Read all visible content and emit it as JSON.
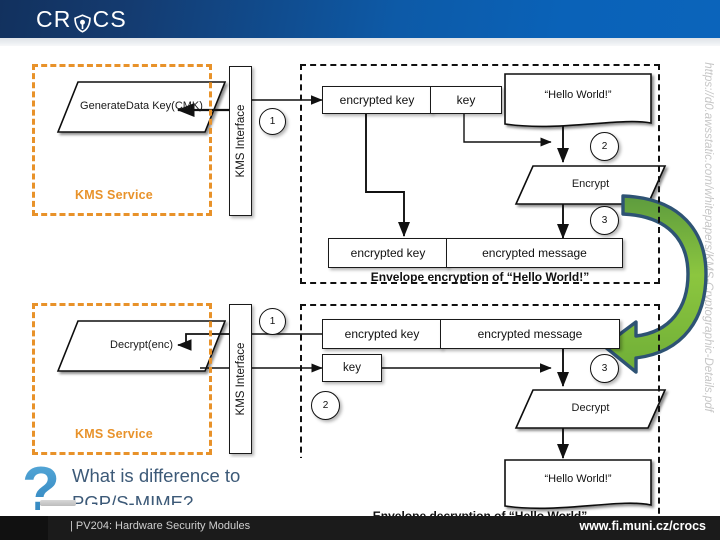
{
  "header": {
    "logo_text_left": "CR",
    "logo_mark": "crocs-shield-icon",
    "logo_text_right": "CS"
  },
  "source_url": "https://d0.awsstatic.com/whitepapers/KMS-Cryptographic-Details.pdf",
  "top_diagram": {
    "kms_service_label": "KMS Service",
    "operation_shape": "GenerateData Key(CMK)",
    "interface_label": "KMS Interface",
    "steps": [
      "1",
      "2",
      "3"
    ],
    "encrypted_key_label": "encrypted key",
    "key_label": "key",
    "plaintext_note": "“Hello World!”",
    "crypto_op": "Encrypt",
    "out_encrypted_key": "encrypted key",
    "out_encrypted_message": "encrypted message",
    "caption": "Envelope encryption of “Hello World!”"
  },
  "bottom_diagram": {
    "kms_service_label": "KMS Service",
    "operation_shape": "Decrypt(enc)",
    "interface_label": "KMS Interface",
    "steps": [
      "1",
      "2",
      "3"
    ],
    "in_encrypted_key": "encrypted key",
    "in_encrypted_message": "encrypted message",
    "key_label": "key",
    "crypto_op": "Decrypt",
    "plaintext_note": "“Hello World!”",
    "caption": "Envelope decryption of “Hello World”"
  },
  "callout": {
    "icon": "question-mark-icon",
    "line1": "What is difference to",
    "line2": "PGP/S-MIME?"
  },
  "footer": {
    "left": "| PV204: Hardware Security Modules",
    "right": "www.fi.muni.cz/crocs"
  },
  "colors": {
    "header_dark": "#12315e",
    "header_light": "#0b64bb",
    "kms_orange": "#e8922a",
    "arrow_green": "#7ab648",
    "arrow_outline": "#2e5374",
    "callout_blue": "#3d5a78",
    "footer_bg": "#1b1b1b"
  }
}
